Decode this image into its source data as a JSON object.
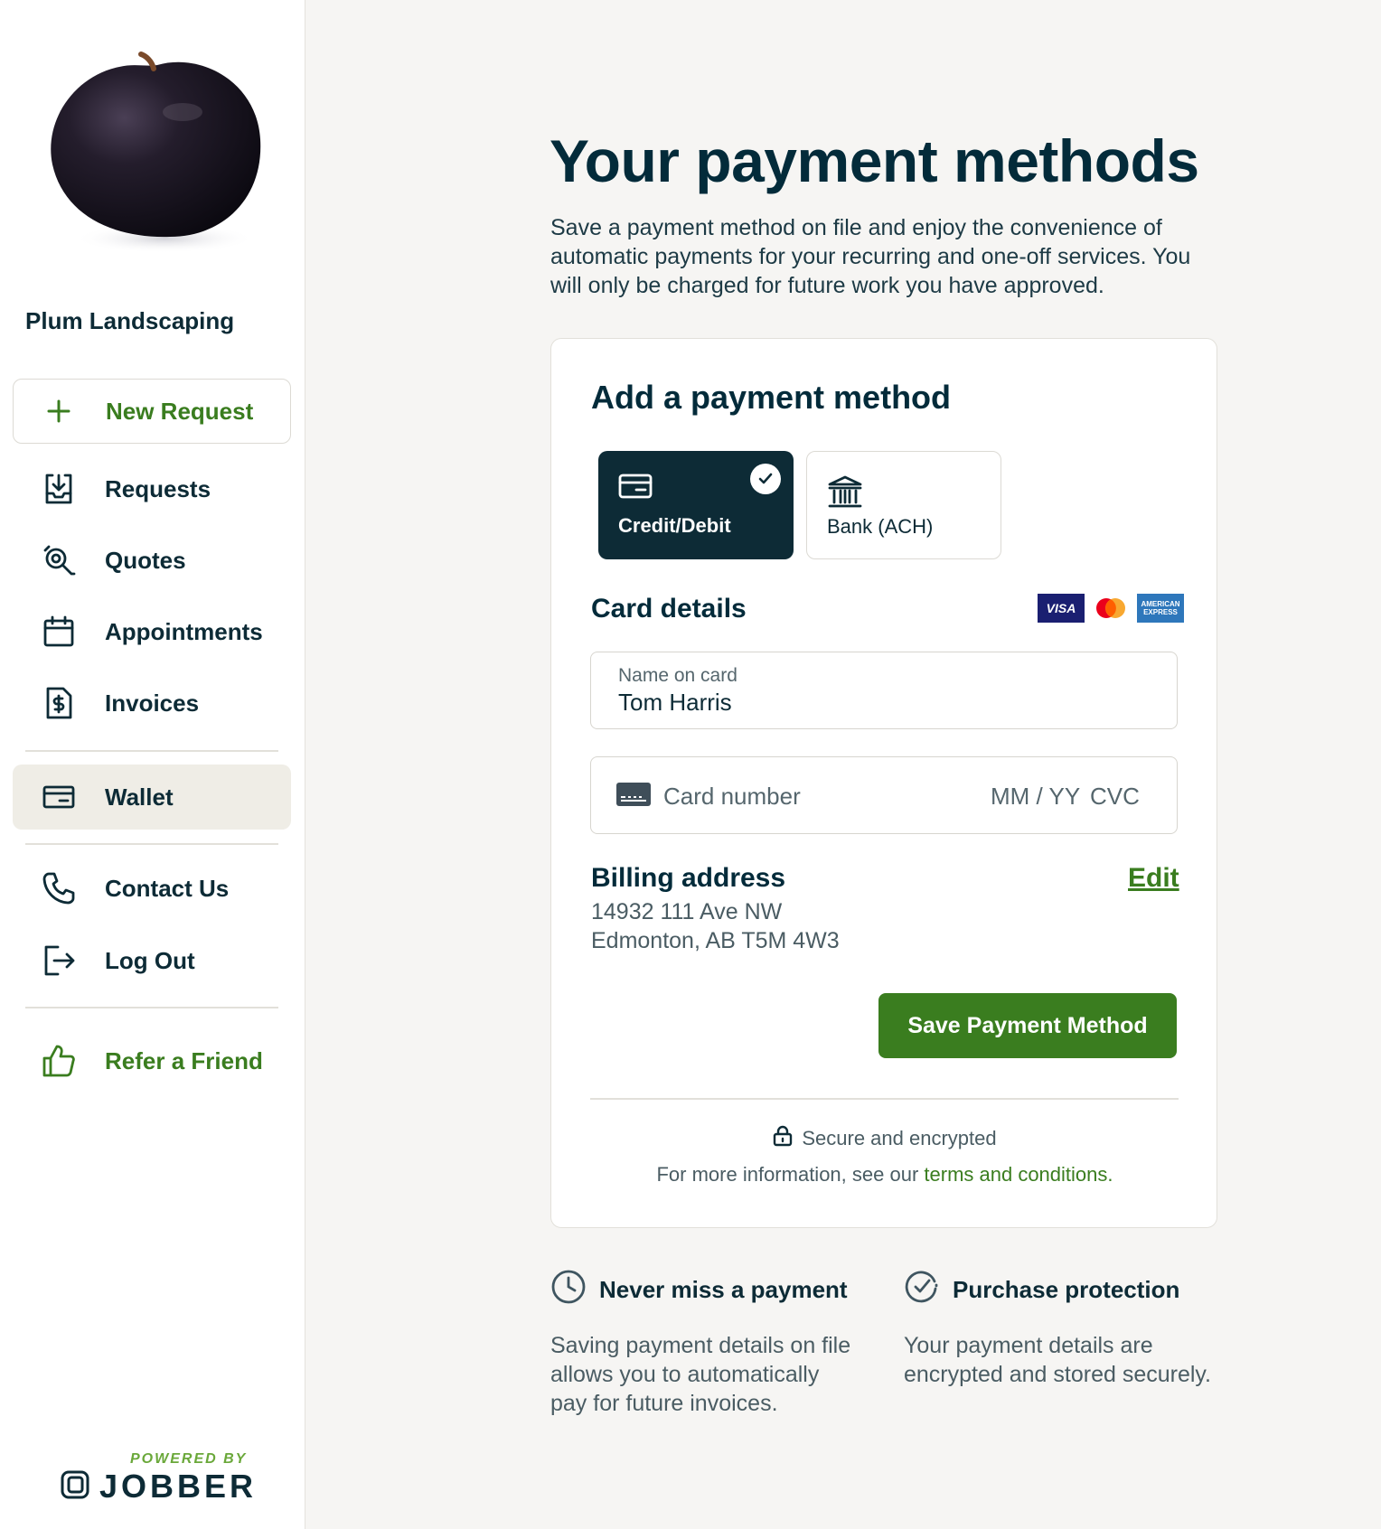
{
  "sidebar": {
    "company_name": "Plum Landscaping",
    "new_request_label": "New Request",
    "items": [
      {
        "label": "Requests",
        "icon": "inbox-download-icon"
      },
      {
        "label": "Quotes",
        "icon": "quote-search-icon"
      },
      {
        "label": "Appointments",
        "icon": "calendar-icon"
      },
      {
        "label": "Invoices",
        "icon": "invoice-dollar-icon"
      },
      {
        "label": "Wallet",
        "icon": "wallet-card-icon",
        "active": true
      },
      {
        "label": "Contact Us",
        "icon": "phone-icon"
      },
      {
        "label": "Log Out",
        "icon": "logout-icon"
      },
      {
        "label": "Refer a Friend",
        "icon": "thumbs-up-icon"
      }
    ],
    "powered_by": "POWERED BY",
    "brand": "JOBBER"
  },
  "main": {
    "title": "Your payment methods",
    "intro": "Save a payment method on file and enjoy the convenience of automatic payments for your recurring and one-off services. You will only be charged for future work you have approved.",
    "card": {
      "heading": "Add a payment method",
      "methods": [
        {
          "label": "Credit/Debit",
          "selected": true
        },
        {
          "label": "Bank (ACH)",
          "selected": false
        }
      ],
      "card_details_label": "Card details",
      "brands": {
        "visa": "VISA",
        "amex_line1": "AMERICAN",
        "amex_line2": "EXPRESS"
      },
      "name_label": "Name on card",
      "name_value": "Tom Harris",
      "card_number_placeholder": "Card number",
      "expiry_placeholder": "MM / YY",
      "cvc_placeholder": "CVC",
      "billing_title": "Billing address",
      "edit_label": "Edit",
      "address_line1": "14932 111 Ave NW",
      "address_line2": "Edmonton, AB T5M 4W3",
      "save_label": "Save Payment Method",
      "secure_label": "Secure and encrypted",
      "terms_prefix": "For more information, see our ",
      "terms_link": "terms and conditions."
    },
    "features": [
      {
        "title": "Never miss a payment",
        "desc": "Saving payment details on file allows you to automatically pay for future invoices.",
        "icon": "clock-icon"
      },
      {
        "title": "Purchase protection",
        "desc": "Your payment details are encrypted and stored securely.",
        "icon": "check-circle-icon"
      }
    ]
  },
  "colors": {
    "brand_green": "#3a7d1f",
    "navy": "#0d2b36",
    "active_bg": "#efede6",
    "page_bg": "#f6f5f3"
  }
}
